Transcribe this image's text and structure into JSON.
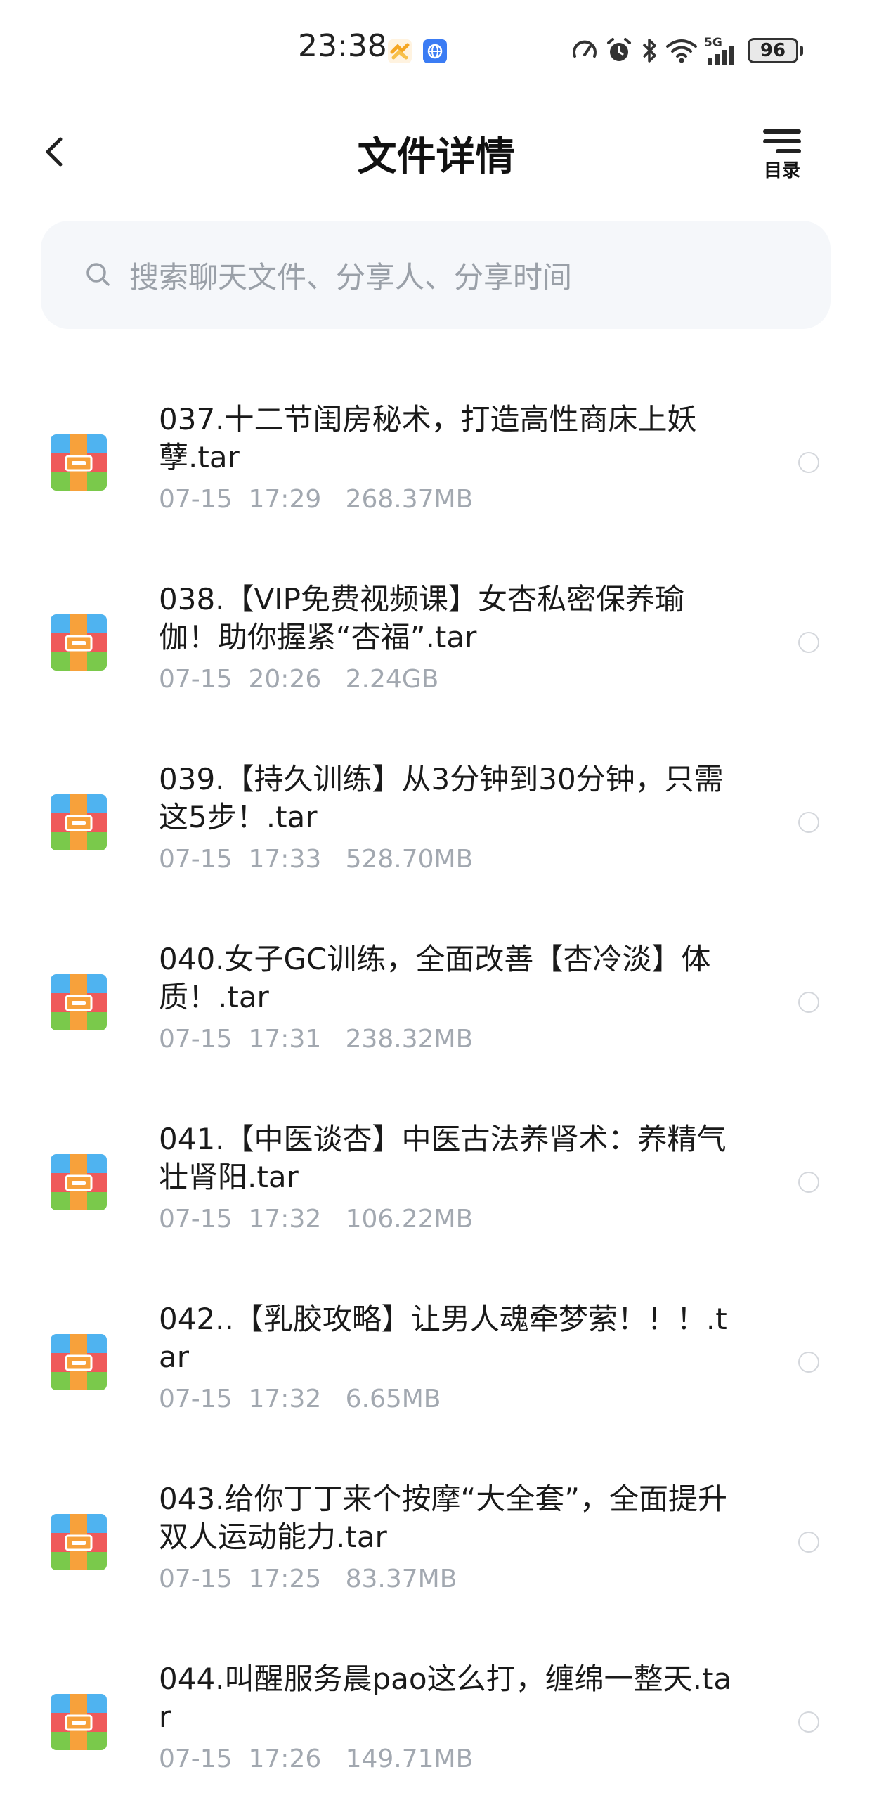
{
  "status_bar": {
    "time": "23:38",
    "battery": "96",
    "network": "5G"
  },
  "header": {
    "title": "文件详情",
    "toc_label": "目录"
  },
  "search": {
    "placeholder": "搜索聊天文件、分享人、分享时间"
  },
  "files": [
    {
      "name": "037.十二节闺房秘术，打造高性商床上妖孽.tar",
      "date": "07-15",
      "time": "17:29",
      "size": "268.37MB"
    },
    {
      "name": "038.【VIP免费视频课】女杏私密保养瑜伽！助你握紧“杏福”.tar",
      "date": "07-15",
      "time": "20:26",
      "size": "2.24GB"
    },
    {
      "name": "039.【持久训练】从3分钟到30分钟，只需这5步！.tar",
      "date": "07-15",
      "time": "17:33",
      "size": "528.70MB"
    },
    {
      "name": "040.女子GC训练，全面改善【杏冷淡】体质！.tar",
      "date": "07-15",
      "time": "17:31",
      "size": "238.32MB"
    },
    {
      "name": "041.【中医谈杏】中医古法养肾术：养精气 壮肾阳.tar",
      "date": "07-15",
      "time": "17:32",
      "size": "106.22MB"
    },
    {
      "name": "042..【乳胶攻略】让男人魂牵梦萦！！！.tar",
      "date": "07-15",
      "time": "17:32",
      "size": "6.65MB"
    },
    {
      "name": "043.给你丁丁来个按摩“大全套”，全面提升双人运动能力.tar",
      "date": "07-15",
      "time": "17:25",
      "size": "83.37MB"
    },
    {
      "name": "044.叫醒服务晨pao这么打，缠绵一整天.tar",
      "date": "07-15",
      "time": "17:26",
      "size": "149.71MB"
    }
  ]
}
